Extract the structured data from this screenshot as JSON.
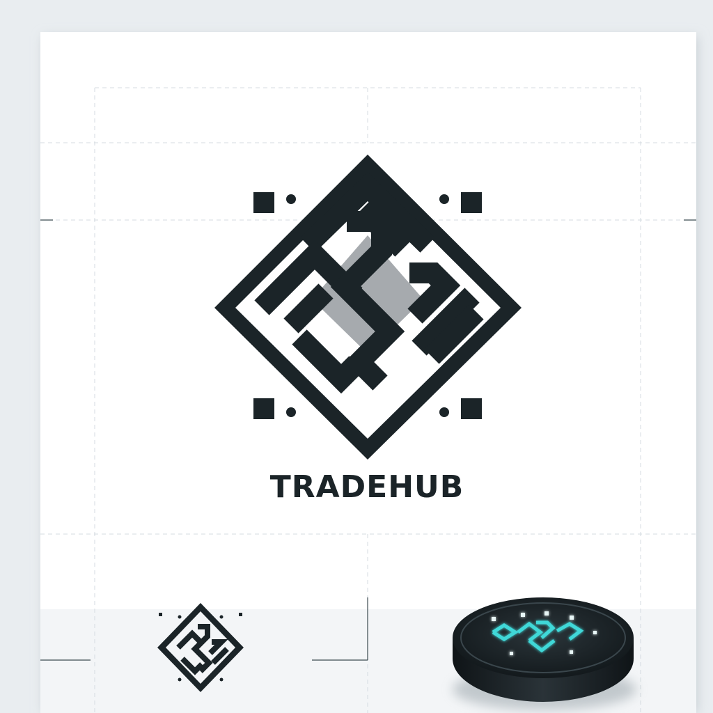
{
  "brand": {
    "name": "TRADEHUB"
  },
  "colors": {
    "ink": "#1b2428",
    "paper": "#ffffff",
    "backdrop": "#e9edf0",
    "guide": "#d4dbe0",
    "accent_gray": "#a6aaae",
    "coin_glow": "#3fd8d8"
  },
  "icons": {
    "main_mark": "diamond-maze-monogram",
    "small_mark": "small-diamond-monogram",
    "coin_mark": "glowing-monogram"
  }
}
